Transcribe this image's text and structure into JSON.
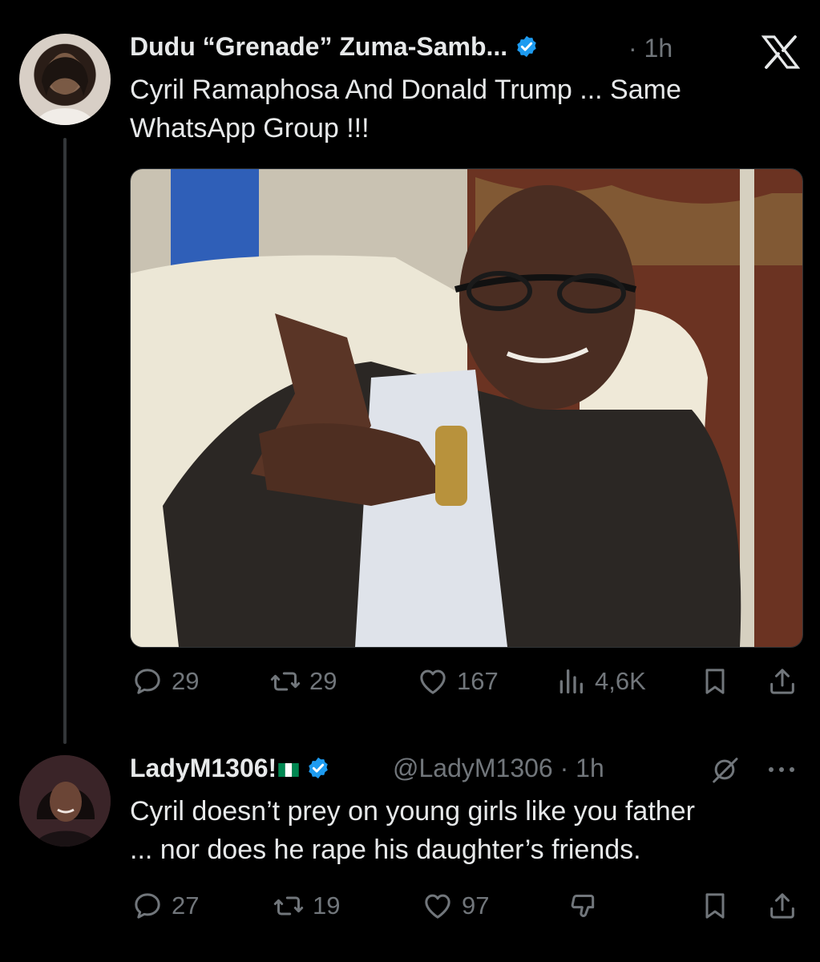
{
  "tweet1": {
    "display_name": "Dudu “Grenade” Zuma-Samb...",
    "time": "· 1h",
    "text": "Cyril Ramaphosa And Donald Trump ... Same WhatsApp Group !!!",
    "text_line1": "Cyril Ramaphosa And Donald Trump ... Same",
    "text_line2": "WhatsApp Group !!!",
    "stats": {
      "replies": "29",
      "reposts": "29",
      "likes": "167",
      "views": "4,6K"
    },
    "avatar_icon": "profile-photo",
    "media_icon": "photo"
  },
  "tweet2": {
    "display_name": "LadyM1306!",
    "flag": "nigeria-flag-icon",
    "handle": "@LadyM1306",
    "time": "· 1h",
    "text_line1": "Cyril doesn’t prey on young girls like you father",
    "text_line2": "... nor does he rape his daughter’s friends.",
    "stats": {
      "replies": "27",
      "reposts": "19",
      "likes": "97"
    }
  },
  "colors": {
    "background": "#000000",
    "text": "#e7e9ea",
    "muted": "#71767b",
    "verified": "#1d9bf0",
    "line": "#333639"
  }
}
